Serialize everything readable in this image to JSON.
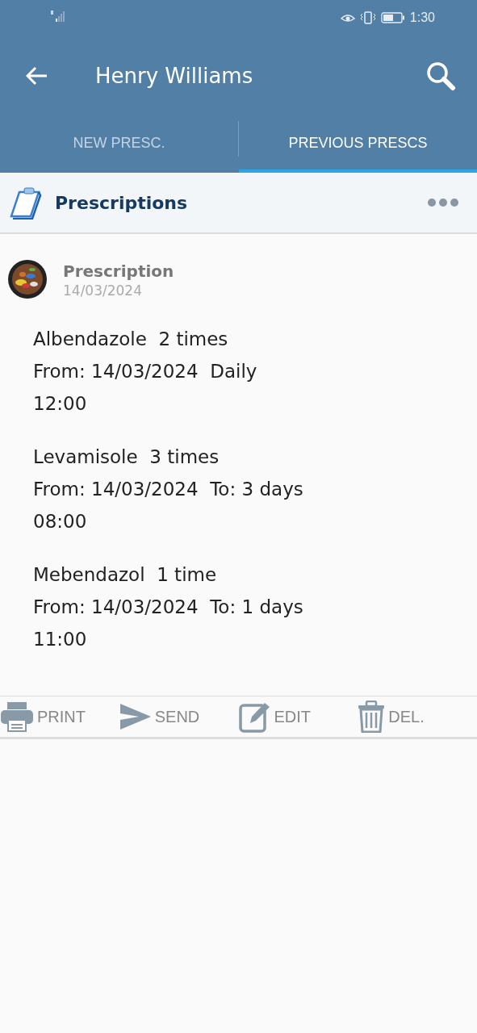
{
  "status_bar": {
    "time": "1:30"
  },
  "app_bar": {
    "title": "Henry Williams"
  },
  "tabs": [
    {
      "label": "NEW PRESC.",
      "selected": false
    },
    {
      "label": "PREVIOUS PRESCS",
      "selected": true
    }
  ],
  "section": {
    "title": "Prescriptions"
  },
  "prescription": {
    "title": "Prescription",
    "date": "14/03/2024",
    "medications": [
      {
        "name": "Albendazole  2 times",
        "period": "From: 14/03/2024  Daily",
        "time": "12:00"
      },
      {
        "name": "Levamisole  3 times",
        "period": "From: 14/03/2024  To: 3 days",
        "time": "08:00"
      },
      {
        "name": "Mebendazol  1 time",
        "period": "From: 14/03/2024  To: 1 days",
        "time": "11:00"
      }
    ]
  },
  "actions": [
    {
      "kind": "print",
      "label": "PRINT"
    },
    {
      "kind": "send",
      "label": "SEND"
    },
    {
      "kind": "edit",
      "label": "EDIT"
    },
    {
      "kind": "delete",
      "label": "DEL."
    }
  ]
}
